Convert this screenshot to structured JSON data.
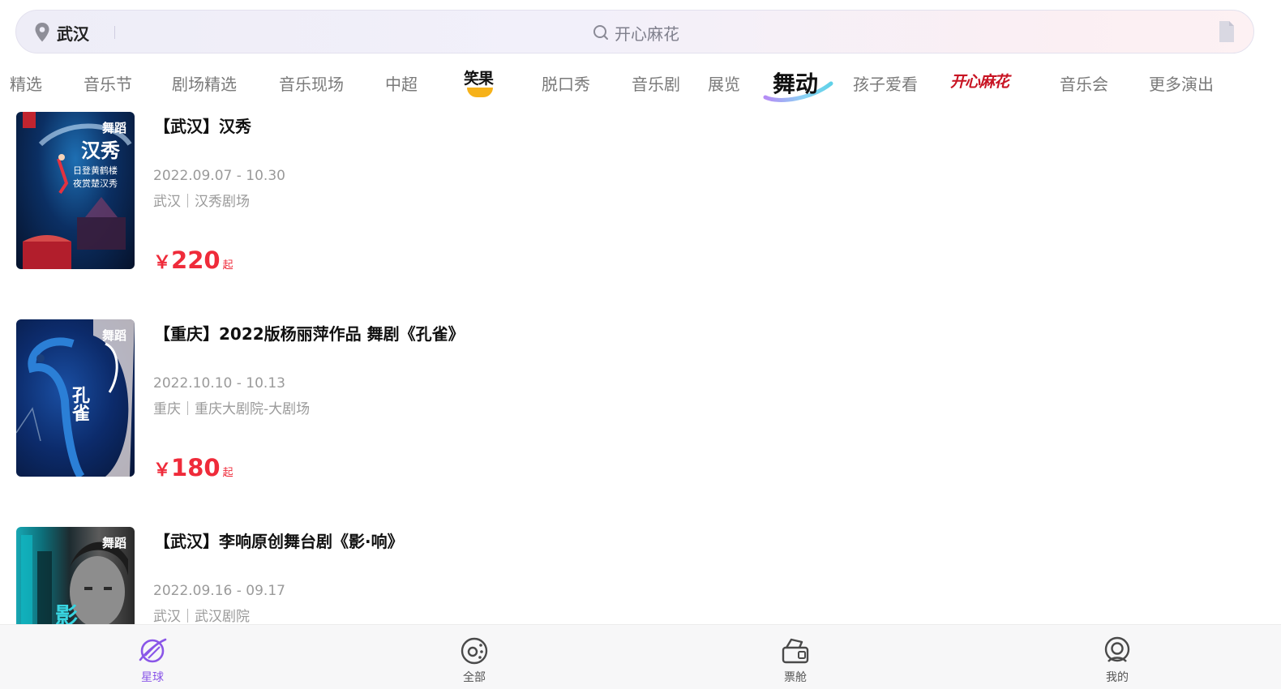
{
  "search": {
    "location": "武汉",
    "placeholder": "开心麻花"
  },
  "tabs": [
    {
      "label": "精选"
    },
    {
      "label": "音乐节"
    },
    {
      "label": "剧场精选"
    },
    {
      "label": "音乐现场"
    },
    {
      "label": "中超"
    },
    {
      "label": "笑果"
    },
    {
      "label": "脱口秀"
    },
    {
      "label": "音乐剧"
    },
    {
      "label": "展览"
    },
    {
      "label": "舞动"
    },
    {
      "label": "孩子爱看"
    },
    {
      "label": "开心麻花"
    },
    {
      "label": "音乐会"
    },
    {
      "label": "更多演出"
    }
  ],
  "events": [
    {
      "tag": "舞蹈",
      "title": "【武汉】汉秀",
      "date": "2022.09.07 - 10.30",
      "venue": "武汉｜汉秀剧场",
      "price_symbol": "￥",
      "price": "220",
      "price_suffix": "起",
      "poster_text": [
        "汉秀",
        "日登黄鹤楼",
        "夜赏楚汉秀"
      ]
    },
    {
      "tag": "舞蹈",
      "title": "【重庆】2022版杨丽萍作品 舞剧《孔雀》",
      "date": "2022.10.10 - 10.13",
      "venue": "重庆｜重庆大剧院-大剧场",
      "price_symbol": "￥",
      "price": "180",
      "price_suffix": "起",
      "poster_text": [
        "孔雀"
      ]
    },
    {
      "tag": "舞蹈",
      "title": "【武汉】李响原创舞台剧《影·响》",
      "date": "2022.09.16 - 09.17",
      "venue": "武汉｜武汉剧院",
      "poster_text": [
        "影"
      ]
    }
  ],
  "bottom_nav": [
    {
      "label": "星球",
      "icon": "planet-icon",
      "active": true
    },
    {
      "label": "全部",
      "icon": "disc-icon",
      "active": false
    },
    {
      "label": "票舱",
      "icon": "ticket-box-icon",
      "active": false
    },
    {
      "label": "我的",
      "icon": "profile-icon",
      "active": false
    }
  ],
  "colors": {
    "price": "#ef2b3a",
    "active_nav": "#8a56e8",
    "kaixin_brand": "#c81423",
    "xiaoguo_brand": "#f6b21a"
  }
}
